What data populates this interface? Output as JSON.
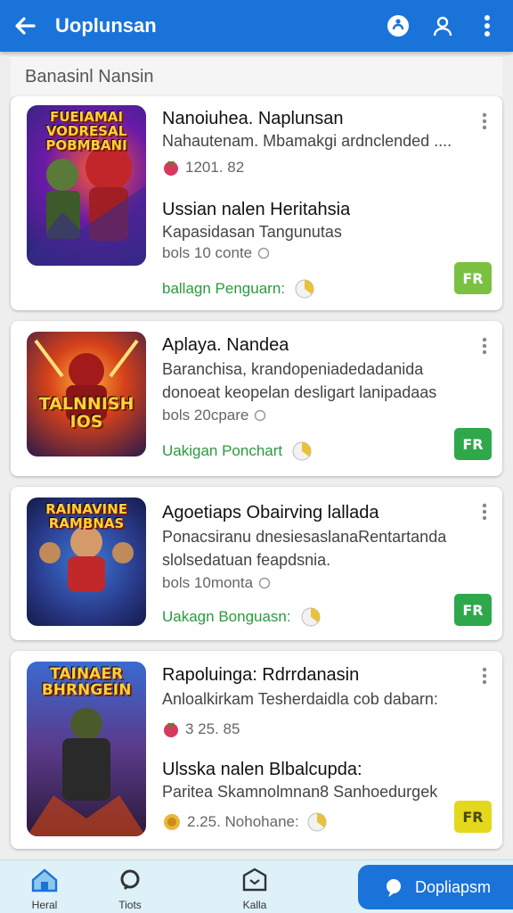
{
  "appbar": {
    "title": "Uoplunsan"
  },
  "section_title": "Banasinl Nansin",
  "cards": [
    {
      "thumb_text": "FUEIAMAI VODRESAL POBMBANI",
      "title": "Nanoiuhea. Naplunsan",
      "line2": "Nahautenam. Mbamakgi ardnclended ....",
      "rating": "1201. 82",
      "sub_title": "Ussian nalen Heritahsia",
      "sub_line": "Kapasidasan Tangunutas",
      "meta": "bols 10 conte",
      "action": "ballagn Penguarn:",
      "badge": "FR"
    },
    {
      "thumb_text": "TALNNISH IOS",
      "title": "Aplaya. Nandea",
      "line2": "Baranchisa, krandopeniadedadanida",
      "line3": "donoeat keopelan desligart lanipadaas",
      "meta": "bols 20cpare",
      "action": "Uakigan Ponchart",
      "badge": "FR"
    },
    {
      "thumb_text": "RAINAVINE RAMBNAS",
      "title": "Agoetiaps Obairving lallada",
      "line2": "Ponacsiranu dnesiesaslanaRentartanda",
      "line3": "slolsedatuan feapdsnia.",
      "meta": "bols 10monta",
      "action": "Uakagn Bonguasn:",
      "badge": "FR"
    },
    {
      "thumb_text": "TAINAER BHRNGEIN",
      "title": "Rapoluinga: Rdrrdanasin",
      "line2": "Anloalkirkam Tesherdaidla cob dabarn:",
      "rating": "3 25. 85",
      "sub_title": "Ulsska nalen Blbalcupda:",
      "sub_line": "Paritea Skamnolmnan8 Sanhoedurgek",
      "rating2": "2.25. Nohohane:",
      "badge": "FR"
    }
  ],
  "nav": [
    {
      "label": "Heral"
    },
    {
      "label": "Tiots"
    },
    {
      "label": "Kalla"
    }
  ],
  "fab_label": "Dopliapsm",
  "colors": {
    "primary": "#1a73d9",
    "green": "#2a9a3e",
    "lime": "#7ac142",
    "yellow": "#e4d81c"
  }
}
